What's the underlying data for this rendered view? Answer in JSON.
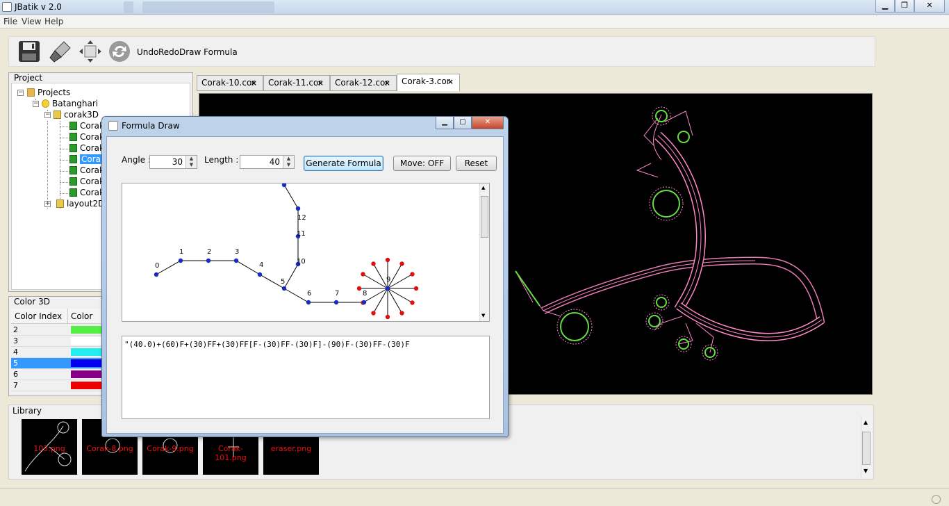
{
  "window": {
    "title": "JBatik v 2.0",
    "min": "▁",
    "max": "❐",
    "close": "✕"
  },
  "menu": {
    "file": "File",
    "view": "View",
    "help": "Help"
  },
  "toolbar": {
    "undo": "Undo",
    "redo": "Redo",
    "draw_formula": "Draw Formula",
    "icons": [
      "save-icon",
      "brush-icon",
      "fit-icon",
      "refresh-icon"
    ]
  },
  "project": {
    "title": "Project",
    "root": "Projects",
    "child": "Batanghari",
    "sub": "corak3D",
    "files": [
      "Corak-",
      "Corak-",
      "Corak-",
      "Corak-",
      "Corak-",
      "Corak-",
      "Corak-"
    ],
    "selected_index": 3,
    "layout": "layout2D"
  },
  "color3d": {
    "title": "Color 3D",
    "headers": [
      "Color Index",
      "Color"
    ],
    "rows": [
      {
        "index": "2",
        "color": "#55ee44"
      },
      {
        "index": "3",
        "color": "#ffffff"
      },
      {
        "index": "4",
        "color": "#22eeee"
      },
      {
        "index": "5",
        "color": "#0000ee"
      },
      {
        "index": "6",
        "color": "#880088"
      },
      {
        "index": "7",
        "color": "#ee0000"
      }
    ],
    "selected_index": 3
  },
  "tabs": [
    {
      "label": "Corak-10.cor",
      "close": "×"
    },
    {
      "label": "Corak-11.cor",
      "close": "×"
    },
    {
      "label": "Corak-12.cor",
      "close": "×"
    },
    {
      "label": "Corak-3.cor",
      "close": "×"
    }
  ],
  "active_tab": 3,
  "library": {
    "title": "Library",
    "items": [
      "103.png",
      "Corak-8.png",
      "Corak-9.png",
      "Corak-101.png",
      "eraser.png"
    ]
  },
  "dialog": {
    "title": "Formula Draw",
    "angle_label": "Angle :",
    "angle_value": "30",
    "length_label": "Length :",
    "length_value": "40",
    "generate": "Generate Formula",
    "move": "Move: OFF",
    "reset": "Reset",
    "formula": "\"(40.0)+(60)F+(30)FF+(30)FF[F-(30)FF-(30)F]-(90)F-(30)FF-(30)F",
    "node_labels": [
      "0",
      "1",
      "2",
      "3",
      "4",
      "5",
      "6",
      "7",
      "8",
      "9",
      "10",
      "11",
      "12"
    ]
  },
  "colors": {
    "accent": "#3399ff",
    "pattern_pink": "#ff88c8",
    "pattern_green": "#66dd44",
    "node_blue": "#1a2bbf",
    "node_red": "#dd1111"
  }
}
